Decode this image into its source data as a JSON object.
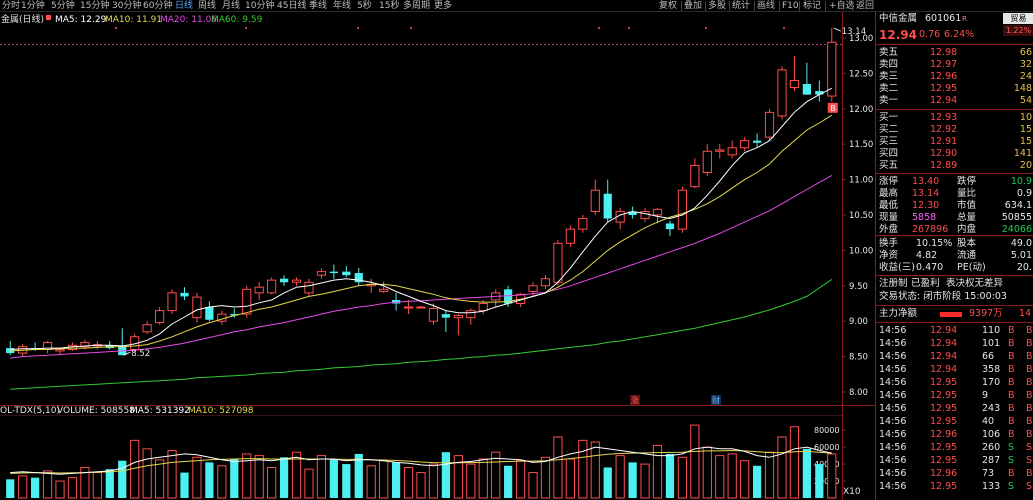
{
  "toolbar": {
    "periods": [
      "分时",
      "1分钟",
      "5分钟",
      "15分钟",
      "30分钟",
      "60分钟",
      "日线",
      "周线",
      "月线",
      "10分钟",
      "45日线",
      "季线",
      "年线",
      "5秒",
      "15秒",
      "多周期",
      "更多"
    ],
    "active_period": "日线",
    "tools": [
      "复权",
      "叠加",
      "多股",
      "统计",
      "画线",
      "F10",
      "标记",
      "+自选",
      "返回"
    ]
  },
  "indicators": {
    "stock_title": "金属(日线)",
    "ma5": "MA5: 12.29",
    "ma10": "MA10: 11.91",
    "ma20": "MA20: 11.06",
    "ma60": "MA60: 9.59",
    "volume_line": "OL-TDX(5,10)",
    "volume": "VOLUME: 508558",
    "vol_ma5": "MA5: 531392",
    "vol_ma10": "MA10: 527098",
    "high_label": "13.14",
    "low_label": "8.52",
    "flag_b": "B",
    "marker_zhang": "涨",
    "marker_cai": "财",
    "vol_x": "X10"
  },
  "colors": {
    "up": "#ff4d4d",
    "down": "#4df0f0",
    "ma5": "#ffffff",
    "ma10": "#e6d84a",
    "ma20": "#e64ae6",
    "ma60": "#33cc33",
    "panel_border": "#8a1c1c"
  },
  "chart_data": [
    {
      "type": "candlestick",
      "title": "金属(日线)",
      "ylim": [
        7.9,
        13.2
      ],
      "yticks": [
        "13.00",
        "12.50",
        "12.00",
        "11.50",
        "11.00",
        "10.50",
        "10.00",
        "9.50",
        "9.00",
        "8.50",
        "8.00"
      ],
      "ohlc": [
        [
          8.62,
          8.72,
          8.52,
          8.55
        ],
        [
          8.55,
          8.68,
          8.5,
          8.64
        ],
        [
          8.62,
          8.7,
          8.58,
          8.6
        ],
        [
          8.6,
          8.72,
          8.55,
          8.7
        ],
        [
          8.58,
          8.63,
          8.52,
          8.6
        ],
        [
          8.6,
          8.7,
          8.58,
          8.66
        ],
        [
          8.64,
          8.74,
          8.6,
          8.7
        ],
        [
          8.65,
          8.72,
          8.6,
          8.67
        ],
        [
          8.66,
          8.72,
          8.6,
          8.62
        ],
        [
          8.66,
          8.9,
          8.55,
          8.52
        ],
        [
          8.6,
          8.82,
          8.56,
          8.78
        ],
        [
          8.85,
          9.0,
          8.82,
          8.95
        ],
        [
          8.98,
          9.2,
          8.95,
          9.15
        ],
        [
          9.15,
          9.45,
          9.1,
          9.4
        ],
        [
          9.4,
          9.48,
          9.3,
          9.35
        ],
        [
          9.05,
          9.4,
          8.98,
          9.34
        ],
        [
          9.2,
          9.28,
          9.0,
          9.02
        ],
        [
          9.0,
          9.15,
          8.95,
          9.1
        ],
        [
          9.1,
          9.18,
          9.05,
          9.08
        ],
        [
          9.1,
          9.5,
          9.05,
          9.45
        ],
        [
          9.4,
          9.55,
          9.3,
          9.48
        ],
        [
          9.4,
          9.62,
          9.38,
          9.58
        ],
        [
          9.6,
          9.65,
          9.5,
          9.55
        ],
        [
          9.55,
          9.62,
          9.5,
          9.58
        ],
        [
          9.4,
          9.6,
          9.35,
          9.55
        ],
        [
          9.65,
          9.75,
          9.6,
          9.7
        ],
        [
          9.7,
          9.8,
          9.6,
          9.68
        ],
        [
          9.7,
          9.78,
          9.62,
          9.65
        ],
        [
          9.68,
          9.75,
          9.5,
          9.55
        ],
        [
          9.5,
          9.6,
          9.4,
          9.52
        ],
        [
          9.42,
          9.56,
          9.4,
          9.45
        ],
        [
          9.3,
          9.4,
          9.15,
          9.25
        ],
        [
          9.2,
          9.3,
          9.1,
          9.2
        ],
        [
          9.2,
          9.22,
          9.18,
          9.2
        ],
        [
          9.0,
          9.25,
          8.95,
          9.18
        ],
        [
          9.1,
          9.15,
          8.85,
          9.05
        ],
        [
          9.05,
          9.1,
          8.8,
          9.08
        ],
        [
          9.05,
          9.18,
          8.95,
          9.15
        ],
        [
          9.15,
          9.3,
          9.1,
          9.25
        ],
        [
          9.3,
          9.45,
          9.2,
          9.4
        ],
        [
          9.45,
          9.5,
          9.2,
          9.25
        ],
        [
          9.25,
          9.4,
          9.2,
          9.38
        ],
        [
          9.42,
          9.55,
          9.35,
          9.5
        ],
        [
          9.5,
          9.65,
          9.45,
          9.6
        ],
        [
          9.55,
          10.15,
          9.5,
          10.1
        ],
        [
          10.1,
          10.35,
          10.05,
          10.3
        ],
        [
          10.3,
          10.5,
          10.25,
          10.45
        ],
        [
          10.55,
          11.0,
          10.5,
          10.85
        ],
        [
          10.8,
          11.0,
          10.4,
          10.45
        ],
        [
          10.4,
          10.6,
          10.3,
          10.55
        ],
        [
          10.55,
          10.62,
          10.45,
          10.5
        ],
        [
          10.45,
          10.6,
          10.4,
          10.55
        ],
        [
          10.5,
          10.6,
          10.38,
          10.58
        ],
        [
          10.38,
          10.42,
          10.2,
          10.3
        ],
        [
          10.3,
          10.9,
          10.25,
          10.85
        ],
        [
          10.9,
          11.3,
          10.88,
          11.2
        ],
        [
          11.1,
          11.5,
          11.05,
          11.4
        ],
        [
          11.4,
          11.5,
          11.3,
          11.42
        ],
        [
          11.35,
          11.55,
          11.3,
          11.45
        ],
        [
          11.45,
          11.6,
          11.4,
          11.55
        ],
        [
          11.55,
          11.65,
          11.45,
          11.52
        ],
        [
          11.6,
          12.0,
          11.55,
          11.95
        ],
        [
          11.9,
          12.6,
          11.85,
          12.55
        ],
        [
          12.3,
          12.75,
          12.25,
          12.4
        ],
        [
          12.35,
          12.65,
          12.25,
          12.2
        ],
        [
          12.25,
          12.4,
          12.1,
          12.2
        ],
        [
          12.18,
          13.14,
          12.1,
          12.94
        ]
      ],
      "ma5": [
        8.6,
        8.61,
        8.61,
        8.62,
        8.62,
        8.64,
        8.65,
        8.66,
        8.66,
        8.65,
        8.68,
        8.73,
        8.82,
        8.96,
        9.06,
        9.16,
        9.2,
        9.22,
        9.2,
        9.21,
        9.26,
        9.3,
        9.4,
        9.48,
        9.5,
        9.54,
        9.58,
        9.6,
        9.58,
        9.55,
        9.5,
        9.42,
        9.35,
        9.28,
        9.22,
        9.15,
        9.12,
        9.12,
        9.14,
        9.2,
        9.25,
        9.3,
        9.35,
        9.4,
        9.55,
        9.75,
        9.98,
        10.2,
        10.4,
        10.5,
        10.55,
        10.52,
        10.48,
        10.45,
        10.5,
        10.6,
        10.78,
        10.98,
        11.2,
        11.38,
        11.45,
        11.55,
        11.75,
        11.95,
        12.1,
        12.2,
        12.29
      ],
      "ma10": [
        8.58,
        8.59,
        8.6,
        8.6,
        8.61,
        8.62,
        8.62,
        8.63,
        8.64,
        8.64,
        8.65,
        8.67,
        8.72,
        8.78,
        8.85,
        8.92,
        8.98,
        9.03,
        9.08,
        9.12,
        9.17,
        9.2,
        9.25,
        9.3,
        9.35,
        9.38,
        9.42,
        9.46,
        9.5,
        9.52,
        9.52,
        9.5,
        9.46,
        9.42,
        9.38,
        9.33,
        9.3,
        9.28,
        9.27,
        9.27,
        9.28,
        9.31,
        9.35,
        9.4,
        9.48,
        9.58,
        9.7,
        9.85,
        10.0,
        10.12,
        10.22,
        10.32,
        10.4,
        10.47,
        10.52,
        10.58,
        10.66,
        10.76,
        10.88,
        11.0,
        11.1,
        11.22,
        11.4,
        11.55,
        11.7,
        11.8,
        11.91
      ],
      "ma20": [
        8.48,
        8.5,
        8.51,
        8.52,
        8.53,
        8.54,
        8.55,
        8.56,
        8.57,
        8.58,
        8.59,
        8.61,
        8.63,
        8.66,
        8.69,
        8.73,
        8.77,
        8.81,
        8.85,
        8.88,
        8.92,
        8.95,
        8.98,
        9.02,
        9.06,
        9.1,
        9.14,
        9.17,
        9.2,
        9.22,
        9.25,
        9.27,
        9.28,
        9.29,
        9.3,
        9.31,
        9.32,
        9.33,
        9.34,
        9.35,
        9.36,
        9.37,
        9.39,
        9.41,
        9.45,
        9.5,
        9.56,
        9.62,
        9.68,
        9.74,
        9.8,
        9.86,
        9.92,
        9.98,
        10.04,
        10.1,
        10.17,
        10.24,
        10.32,
        10.4,
        10.48,
        10.56,
        10.66,
        10.76,
        10.86,
        10.96,
        11.06
      ],
      "ma60": [
        8.04,
        8.05,
        8.06,
        8.07,
        8.08,
        8.09,
        8.1,
        8.11,
        8.12,
        8.13,
        8.14,
        8.15,
        8.16,
        8.17,
        8.18,
        8.2,
        8.21,
        8.22,
        8.23,
        8.24,
        8.26,
        8.27,
        8.28,
        8.3,
        8.31,
        8.32,
        8.34,
        8.35,
        8.36,
        8.38,
        8.39,
        8.4,
        8.42,
        8.43,
        8.44,
        8.46,
        8.47,
        8.49,
        8.5,
        8.52,
        8.53,
        8.55,
        8.57,
        8.59,
        8.61,
        8.63,
        8.65,
        8.67,
        8.7,
        8.72,
        8.75,
        8.78,
        8.81,
        8.84,
        8.87,
        8.9,
        8.94,
        8.98,
        9.02,
        9.06,
        9.11,
        9.16,
        9.22,
        9.28,
        9.35,
        9.47,
        9.59
      ]
    },
    {
      "type": "bar",
      "title": "OL-TDX(5,10)",
      "ylim": [
        0,
        92000
      ],
      "yticks": [
        "80000",
        "60000",
        "40000",
        "20000"
      ],
      "volume": [
        22000,
        26000,
        24000,
        32000,
        20000,
        24000,
        36000,
        30000,
        34000,
        44000,
        68000,
        58000,
        45000,
        56000,
        30000,
        48000,
        42000,
        38000,
        46000,
        52000,
        50000,
        36000,
        48000,
        54000,
        34000,
        50000,
        46000,
        40000,
        52000,
        38000,
        44000,
        42000,
        36000,
        30000,
        40000,
        54000,
        50000,
        40000,
        46000,
        54000,
        38000,
        44000,
        30000,
        48000,
        72000,
        46000,
        68000,
        66000,
        36000,
        50000,
        42000,
        40000,
        62000,
        52000,
        48000,
        86000,
        60000,
        50000,
        52000,
        44000,
        38000,
        54000,
        72000,
        84000,
        58000,
        40000,
        52000
      ],
      "vol_ma5": [
        30000,
        31000,
        30000,
        29000,
        28000,
        29000,
        30000,
        31000,
        32000,
        35000,
        42000,
        46000,
        48000,
        50000,
        52000,
        51000,
        48000,
        45000,
        43000,
        44000,
        45000,
        44000,
        46000,
        48000,
        45000,
        46000,
        46000,
        44000,
        45000,
        45000,
        44000,
        42000,
        41000,
        39000,
        38000,
        40000,
        42000,
        43000,
        45000,
        47000,
        46000,
        45000,
        42000,
        43000,
        48000,
        52000,
        55000,
        60000,
        58000,
        56000,
        54000,
        52000,
        50000,
        50000,
        52000,
        58000,
        60000,
        58000,
        58000,
        55000,
        50000,
        48000,
        52000,
        58000,
        60000,
        56000,
        53000
      ],
      "vol_ma10": [
        29000,
        29500,
        30000,
        30000,
        29500,
        29800,
        30000,
        30500,
        31000,
        32000,
        35000,
        38000,
        40000,
        42000,
        43000,
        44000,
        45000,
        45500,
        46000,
        46500,
        46500,
        46000,
        45800,
        46000,
        46000,
        46000,
        45800,
        45500,
        45500,
        45000,
        44800,
        44200,
        43500,
        42500,
        41800,
        41500,
        41500,
        41800,
        42000,
        42500,
        43000,
        43500,
        43500,
        44000,
        45000,
        46500,
        48000,
        50000,
        51500,
        52500,
        53000,
        53200,
        53500,
        53800,
        54000,
        55000,
        55500,
        55500,
        56000,
        55500,
        54500,
        53500,
        53500,
        54500,
        55000,
        54000,
        52700
      ]
    }
  ],
  "quote": {
    "name": "中信金属",
    "code": "601061",
    "tag": "R",
    "price": "12.94",
    "change": "0.76",
    "change_pct": "6.24%",
    "badge_top": "贸易",
    "badge_bottom": "1.22%",
    "asks": [
      {
        "label": "卖五",
        "price": "12.98",
        "vol": "66"
      },
      {
        "label": "卖四",
        "price": "12.97",
        "vol": "32"
      },
      {
        "label": "卖三",
        "price": "12.96",
        "vol": "24"
      },
      {
        "label": "卖二",
        "price": "12.95",
        "vol": "148"
      },
      {
        "label": "卖一",
        "price": "12.94",
        "vol": "54"
      }
    ],
    "bids": [
      {
        "label": "买一",
        "price": "12.93",
        "vol": "10"
      },
      {
        "label": "买二",
        "price": "12.92",
        "vol": "15"
      },
      {
        "label": "买三",
        "price": "12.91",
        "vol": "15"
      },
      {
        "label": "买四",
        "price": "12.90",
        "vol": "141"
      },
      {
        "label": "买五",
        "price": "12.89",
        "vol": "20"
      }
    ],
    "stats": [
      {
        "l1": "涨停",
        "v1": "13.40",
        "l2": "跌停",
        "v2": "10.9"
      },
      {
        "l1": "最高",
        "v1": "13.14",
        "l2": "量比",
        "v2": "0.9"
      },
      {
        "l1": "最低",
        "v1": "12.30",
        "l2": "市值",
        "v2": "634.1"
      },
      {
        "l1": "现量",
        "v1": "5858",
        "l2": "总量",
        "v2": "50855"
      },
      {
        "l1": "外盘",
        "v1": "267896",
        "l2": "内盘",
        "v2": "24066"
      }
    ],
    "fund": [
      {
        "l1": "换手",
        "v1": "10.15%",
        "l2": "股本",
        "v2": "49.0"
      },
      {
        "l1": "净资",
        "v1": "4.82",
        "l2": "流通",
        "v2": "5.01"
      },
      {
        "l1": "收益(三)",
        "v1": "0.470",
        "l2": "PE(动)",
        "v2": "20."
      }
    ],
    "reg_label": "注册制",
    "profit_label": "已盈利",
    "vote_label": "表决权无差异",
    "trade_status": "交易状态: 闭市阶段 15:00:03",
    "net_label": "主力净额",
    "net_value": "9397万",
    "net_extra": "14",
    "ticks": [
      {
        "t": "14:56",
        "p": "12.94",
        "v": "110",
        "d": "B"
      },
      {
        "t": "14:56",
        "p": "12.94",
        "v": "101",
        "d": "B"
      },
      {
        "t": "14:56",
        "p": "12.94",
        "v": "66",
        "d": "B"
      },
      {
        "t": "14:56",
        "p": "12.94",
        "v": "358",
        "d": "B"
      },
      {
        "t": "14:56",
        "p": "12.95",
        "v": "170",
        "d": "B"
      },
      {
        "t": "14:56",
        "p": "12.95",
        "v": "9",
        "d": "B"
      },
      {
        "t": "14:56",
        "p": "12.95",
        "v": "243",
        "d": "B"
      },
      {
        "t": "14:56",
        "p": "12.95",
        "v": "40",
        "d": "B"
      },
      {
        "t": "14:56",
        "p": "12.96",
        "v": "106",
        "d": "B"
      },
      {
        "t": "14:56",
        "p": "12.95",
        "v": "260",
        "d": "S"
      },
      {
        "t": "14:56",
        "p": "12.95",
        "v": "287",
        "d": "S"
      },
      {
        "t": "14:56",
        "p": "12.96",
        "v": "73",
        "d": "B"
      },
      {
        "t": "14:56",
        "p": "12.95",
        "v": "133",
        "d": "S"
      }
    ]
  }
}
